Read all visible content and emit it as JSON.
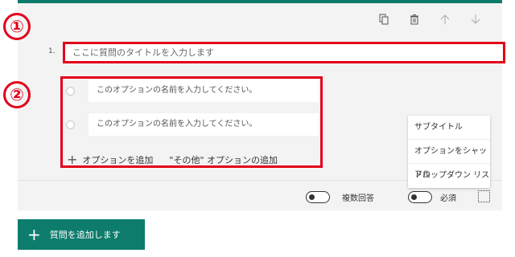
{
  "markers": [
    "①",
    "②"
  ],
  "question": {
    "number": "1.",
    "title_placeholder": "ここに質問のタイトルを入力します"
  },
  "options": [
    {
      "placeholder": "このオプションの名前を入力してください。"
    },
    {
      "placeholder": "このオプションの名前を入力してください。"
    }
  ],
  "add_option": {
    "add_label": "オプションを追加",
    "other_label": "\"その他\" オプションの追加"
  },
  "context_menu": {
    "items": [
      "サブタイトル",
      "オプションをシャッフル",
      "ドロップダウン リスト"
    ]
  },
  "footer": {
    "multiple_answers_label": "複数回答",
    "required_label": "必須"
  },
  "add_question_button": "質問を追加します",
  "colors": {
    "accent": "#0b7a6b",
    "highlight": "#e2001a"
  },
  "icons": [
    "copy-icon",
    "delete-icon",
    "move-up-icon",
    "move-down-icon",
    "more-options-icon"
  ]
}
